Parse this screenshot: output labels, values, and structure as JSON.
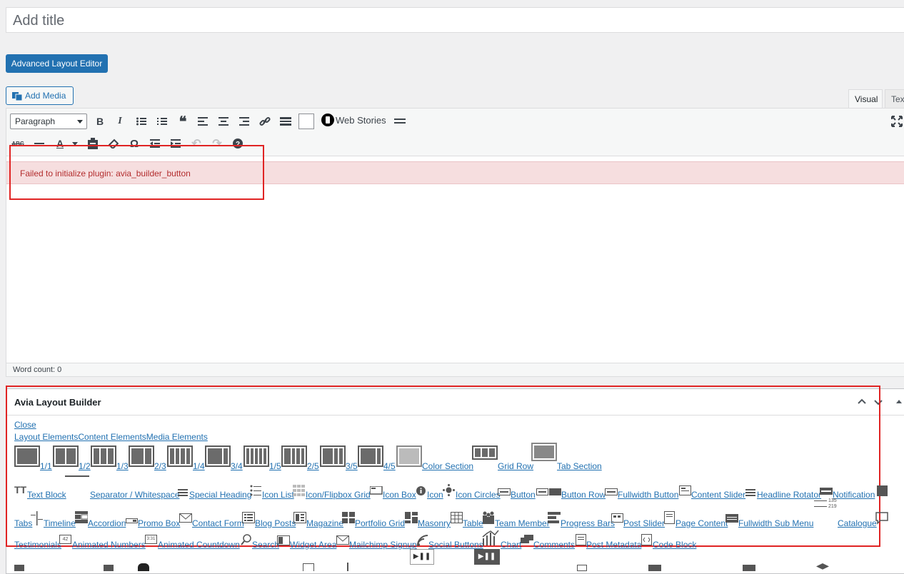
{
  "editor": {
    "title_placeholder": "Add title",
    "advanced_layout_button": "Advanced Layout Editor",
    "add_media_button": "Add Media",
    "tabs": [
      "Visual",
      "Text"
    ],
    "format_select": "Paragraph",
    "web_stories_label": "Web Stories",
    "error_message": "Failed to initialize plugin: avia_builder_button",
    "word_count": "Word count: 0"
  },
  "avia": {
    "title": "Avia Layout Builder",
    "close_link": "Close",
    "tabs": [
      "Layout Elements",
      "Content Elements",
      "Media Elements"
    ],
    "layout_row": [
      "1/1",
      "1/2",
      "1/3",
      "2/3",
      "1/4",
      "3/4",
      "1/5",
      "2/5",
      "3/5",
      "4/5",
      "Color Section",
      "Grid Row",
      "Tab Section"
    ],
    "content_row1": [
      "Text Block",
      "Separator / Whitespace",
      "Special Heading",
      "Icon List",
      "Icon/Flipbox Grid",
      "Icon Box",
      "Icon",
      "Icon Circles",
      "Button",
      "Button Row",
      "Fullwidth Button",
      "Content Slider",
      "Headline Rotator",
      "Notification"
    ],
    "content_row2": [
      "Tabs",
      "Timeline",
      "Accordion",
      "Promo Box",
      "Contact Form",
      "Blog Posts",
      "Magazine",
      "Portfolio Grid",
      "Masonry",
      "Table",
      "Team Member",
      "Progress Bars",
      "Post Slider",
      "Page Content",
      "Fullwidth Sub Menu",
      "Catalogue"
    ],
    "content_row3": [
      "Testimonials",
      "Animated Numbers",
      "Animated Countdown",
      "Search",
      "Widget Area",
      "Mailchimp Signup",
      "Social Buttons",
      "Chart",
      "Comments",
      "Post Metadata",
      "Code Block"
    ],
    "notification_icon_numbers": [
      "135",
      "219"
    ],
    "animated_numbers_icon": "42",
    "countdown_icon": "3:31"
  }
}
